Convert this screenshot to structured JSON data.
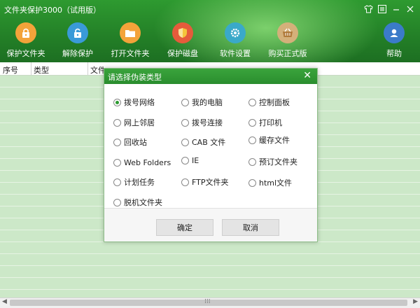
{
  "window": {
    "title": "文件夹保护3000（试用版）",
    "buttons": [
      "shirt-icon",
      "menu-icon",
      "minimize-icon",
      "close-icon"
    ]
  },
  "toolbar": [
    {
      "id": "protect-folder",
      "label": "保护文件夹",
      "icon": "lock-icon",
      "color": "#f2a23a"
    },
    {
      "id": "unprotect",
      "label": "解除保护",
      "icon": "unlock-icon",
      "color": "#3a9ad8"
    },
    {
      "id": "open-folder",
      "label": "打开文件夹",
      "icon": "folder-icon",
      "color": "#f2a23a"
    },
    {
      "id": "protect-disk",
      "label": "保护磁盘",
      "icon": "shield-icon",
      "color": "#e05a3a"
    },
    {
      "id": "settings",
      "label": "软件设置",
      "icon": "gear-icon",
      "color": "#3aa8c8"
    },
    {
      "id": "buy",
      "label": "购买正式版",
      "icon": "basket-icon",
      "color": "#c8a26a"
    },
    {
      "id": "help",
      "label": "帮助",
      "icon": "user-icon",
      "color": "#3a7ac8"
    }
  ],
  "table": {
    "columns": [
      "序号",
      "类型",
      "文件"
    ]
  },
  "dialog": {
    "title": "请选择伪装类型",
    "options": [
      {
        "label": "拨号网络",
        "selected": true
      },
      {
        "label": "我的电脑",
        "selected": false
      },
      {
        "label": "控制面板",
        "selected": false
      },
      {
        "label": "网上邻居",
        "selected": false
      },
      {
        "label": "拨号连接",
        "selected": false
      },
      {
        "label": "打印机",
        "selected": false
      },
      {
        "label": "回收站",
        "selected": false
      },
      {
        "label": "CAB 文件",
        "selected": false
      },
      {
        "label": "缓存文件",
        "selected": false
      },
      {
        "label": "Web Folders",
        "selected": false
      },
      {
        "label": "IE",
        "selected": false
      },
      {
        "label": "预订文件夹",
        "selected": false
      },
      {
        "label": "计划任务",
        "selected": false
      },
      {
        "label": "FTP文件夹",
        "selected": false
      },
      {
        "label": "html文件",
        "selected": false
      },
      {
        "label": "脱机文件夹",
        "selected": false
      }
    ],
    "ok_label": "确定",
    "cancel_label": "取消"
  }
}
